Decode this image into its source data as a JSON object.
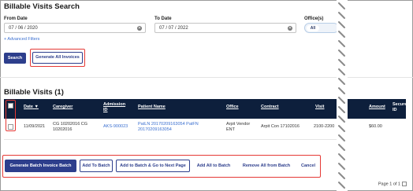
{
  "page_title": "Billable Visits Search",
  "filters": {
    "from_date_label": "From Date",
    "from_date_value": "07 / 06 / 2020",
    "to_date_label": "To Date",
    "to_date_value": "07 / 07 / 2022",
    "office_label": "Office(s)",
    "office_value": "All",
    "advanced_label": "+ Advanced Filters"
  },
  "actions": {
    "search_label": "Search",
    "generate_all_label": "Generate All Invoices"
  },
  "section_title": "Billable Visits (1)",
  "table": {
    "headers": {
      "date": "Date",
      "caregiver": "Caregiver",
      "admission_id_1": "Admission",
      "admission_id_2": "ID",
      "patient_name": "Patient Name",
      "office": "Office",
      "contract": "Contract",
      "visit": "Visit",
      "amount": "Amount",
      "secure_id_1": "Secure",
      "secure_id_2": "ID"
    },
    "rows": [
      {
        "date": "11/09/2021",
        "caregiver_1": "CG 10202016 CG",
        "caregiver_2": "10202016",
        "admission_id": "AKS-900023",
        "patient_1": "PatLN 20170209163054 PatFN",
        "patient_2": "20170209163054",
        "office_1": "Arpit Vendor",
        "office_2": "ENT",
        "contract": "Arpit Con 17102016",
        "visit": "2100-2200",
        "amount": "$60.00"
      }
    ]
  },
  "bottom_actions": {
    "generate_batch": "Generate Batch Invoice Batch",
    "add_to_batch": "Add To Batch",
    "add_next_page": "Add to Batch & Go to Next Page",
    "add_all": "Add All to Batch",
    "remove_all": "Remove All from Batch",
    "cancel": "Cancel"
  },
  "pager": {
    "text": "Page 1 of 1"
  },
  "colors": {
    "primary": "#2d3e8c",
    "table_header": "#0d1f3c",
    "link": "#3a6fd0",
    "highlight": "#e53935"
  },
  "icons": {
    "clear": "clear-icon",
    "sort": "sort-arrow-icon"
  }
}
